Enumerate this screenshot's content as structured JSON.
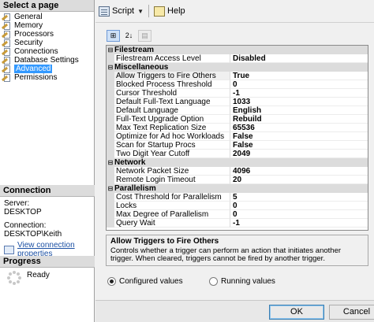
{
  "left": {
    "select_page_header": "Select a page",
    "pages": [
      {
        "label": "General",
        "selected": false
      },
      {
        "label": "Memory",
        "selected": false
      },
      {
        "label": "Processors",
        "selected": false
      },
      {
        "label": "Security",
        "selected": false
      },
      {
        "label": "Connections",
        "selected": false
      },
      {
        "label": "Database Settings",
        "selected": false
      },
      {
        "label": "Advanced",
        "selected": true
      },
      {
        "label": "Permissions",
        "selected": false
      }
    ],
    "connection_header": "Connection",
    "server_label": "Server:",
    "server_value": "DESKTOP",
    "connection_label": "Connection:",
    "connection_value": "DESKTOP\\Keith",
    "view_props_link": "View connection properties",
    "progress_header": "Progress",
    "progress_status": "Ready"
  },
  "toolbar": {
    "script_label": "Script",
    "help_label": "Help"
  },
  "grid_tools": {
    "categorized_glyph": "⊞",
    "alpha_glyph": "2↓",
    "pages_glyph": "▤"
  },
  "grid": {
    "categories": [
      {
        "name": "Filestream",
        "rows": [
          {
            "name": "Filestream Access Level",
            "value": "Disabled"
          }
        ]
      },
      {
        "name": "Miscellaneous",
        "rows": [
          {
            "name": "Allow Triggers to Fire Others",
            "value": "True"
          },
          {
            "name": "Blocked Process Threshold",
            "value": "0"
          },
          {
            "name": "Cursor Threshold",
            "value": "-1"
          },
          {
            "name": "Default Full-Text Language",
            "value": "1033"
          },
          {
            "name": "Default Language",
            "value": "English"
          },
          {
            "name": "Full-Text Upgrade Option",
            "value": "Rebuild"
          },
          {
            "name": "Max Text Replication Size",
            "value": "65536"
          },
          {
            "name": "Optimize for Ad hoc Workloads",
            "value": "False"
          },
          {
            "name": "Scan for Startup Procs",
            "value": "False"
          },
          {
            "name": "Two Digit Year Cutoff",
            "value": "2049"
          }
        ]
      },
      {
        "name": "Network",
        "rows": [
          {
            "name": "Network Packet Size",
            "value": "4096"
          },
          {
            "name": "Remote Login Timeout",
            "value": "20"
          }
        ]
      },
      {
        "name": "Parallelism",
        "rows": [
          {
            "name": "Cost Threshold for Parallelism",
            "value": "5"
          },
          {
            "name": "Locks",
            "value": "0"
          },
          {
            "name": "Max Degree of Parallelism",
            "value": "0"
          },
          {
            "name": "Query Wait",
            "value": "-1"
          }
        ]
      }
    ],
    "selected_row": "Allow Triggers to Fire Others"
  },
  "description": {
    "title": "Allow Triggers to Fire Others",
    "text": "Controls whether a trigger can perform an action that initiates another trigger. When cleared, triggers cannot be fired by another trigger."
  },
  "radios": {
    "configured": "Configured values",
    "running": "Running values",
    "selected": "configured"
  },
  "buttons": {
    "ok": "OK",
    "cancel": "Cancel"
  },
  "icons": {
    "collapse": "⊟"
  }
}
